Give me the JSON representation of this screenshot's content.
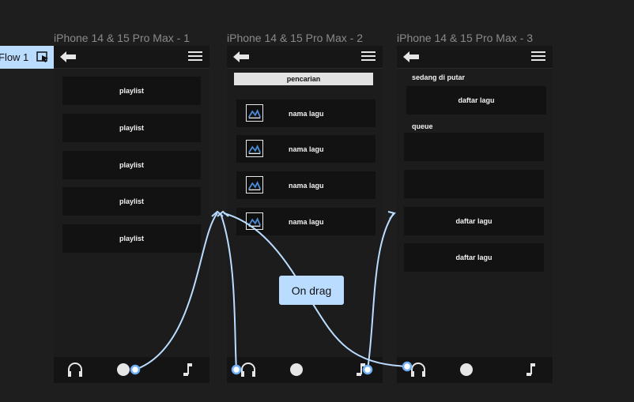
{
  "flow": {
    "label": "Flow 1"
  },
  "frames": [
    {
      "title": "iPhone 14 & 15 Pro Max - 1",
      "items": [
        "playlist",
        "playlist",
        "playlist",
        "playlist",
        "playlist"
      ]
    },
    {
      "title": "iPhone 14 & 15 Pro Max - 2",
      "search_label": "pencarian",
      "songs": [
        "nama lagu",
        "nama lagu",
        "nama lagu",
        "nama lagu"
      ]
    },
    {
      "title": "iPhone 14 & 15 Pro Max - 3",
      "now_playing_label": "sedang di putar",
      "now_playing_item": "daftar lagu",
      "queue_label": "queue",
      "queue_items": [
        "",
        "",
        "daftar lagu",
        "daftar lagu"
      ]
    }
  ],
  "interaction": {
    "trigger_label": "On drag"
  },
  "icons": {
    "back": "arrow-left-icon",
    "menu": "hamburger-menu-icon",
    "song": "image-icon",
    "home": "headphones-icon",
    "search": "circle-icon",
    "music": "music-note-icon",
    "play": "play-icon"
  },
  "colors": {
    "canvas": "#1e1e1e",
    "frame": "#1c1c1c",
    "card": "#121212",
    "flow": "#b9dcff"
  }
}
